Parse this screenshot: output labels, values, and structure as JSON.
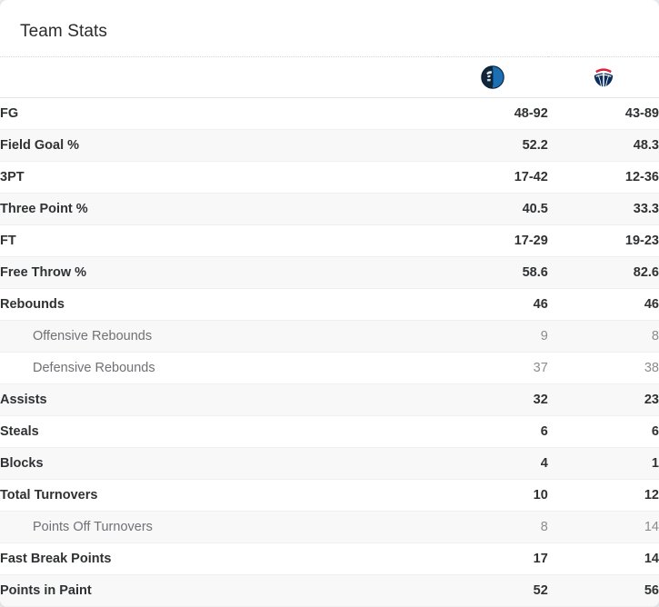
{
  "card": {
    "title": "Team Stats"
  },
  "header": {
    "label_column_header": "",
    "teams": [
      {
        "name": "Dallas Mavericks",
        "abbr": "DAL",
        "icon": "mavericks-logo-icon",
        "primary_color": "#00538C",
        "secondary_color": "#002B5E"
      },
      {
        "name": "Washington Wizards",
        "abbr": "WAS",
        "icon": "wizards-logo-icon",
        "primary_color": "#002B5C",
        "secondary_color": "#E31837"
      }
    ]
  },
  "stats": [
    {
      "label": "FG",
      "sub": false,
      "values": [
        "48-92",
        "43-89"
      ]
    },
    {
      "label": "Field Goal %",
      "sub": false,
      "values": [
        "52.2",
        "48.3"
      ]
    },
    {
      "label": "3PT",
      "sub": false,
      "values": [
        "17-42",
        "12-36"
      ]
    },
    {
      "label": "Three Point %",
      "sub": false,
      "values": [
        "40.5",
        "33.3"
      ]
    },
    {
      "label": "FT",
      "sub": false,
      "values": [
        "17-29",
        "19-23"
      ]
    },
    {
      "label": "Free Throw %",
      "sub": false,
      "values": [
        "58.6",
        "82.6"
      ]
    },
    {
      "label": "Rebounds",
      "sub": false,
      "values": [
        "46",
        "46"
      ]
    },
    {
      "label": "Offensive Rebounds",
      "sub": true,
      "values": [
        "9",
        "8"
      ]
    },
    {
      "label": "Defensive Rebounds",
      "sub": true,
      "values": [
        "37",
        "38"
      ]
    },
    {
      "label": "Assists",
      "sub": false,
      "values": [
        "32",
        "23"
      ]
    },
    {
      "label": "Steals",
      "sub": false,
      "values": [
        "6",
        "6"
      ]
    },
    {
      "label": "Blocks",
      "sub": false,
      "values": [
        "4",
        "1"
      ]
    },
    {
      "label": "Total Turnovers",
      "sub": false,
      "values": [
        "10",
        "12"
      ]
    },
    {
      "label": "Points Off Turnovers",
      "sub": true,
      "values": [
        "8",
        "14"
      ]
    },
    {
      "label": "Fast Break Points",
      "sub": false,
      "values": [
        "17",
        "14"
      ]
    },
    {
      "label": "Points in Paint",
      "sub": false,
      "values": [
        "52",
        "56"
      ]
    }
  ]
}
